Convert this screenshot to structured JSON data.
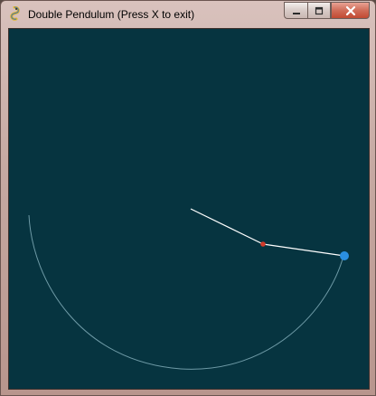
{
  "window": {
    "title": "Double Pendulum (Press X to exit)",
    "icon": "pygame-snake-icon"
  },
  "controls": {
    "minimize": "minimize-icon",
    "maximize": "maximize-icon",
    "close": "close-icon"
  },
  "colors": {
    "canvas_background": "#063440",
    "rods": "#ffffff",
    "first_bob": "#d23a2a",
    "second_bob": "#2a8fe0",
    "trail": "#6e9aa6"
  }
}
